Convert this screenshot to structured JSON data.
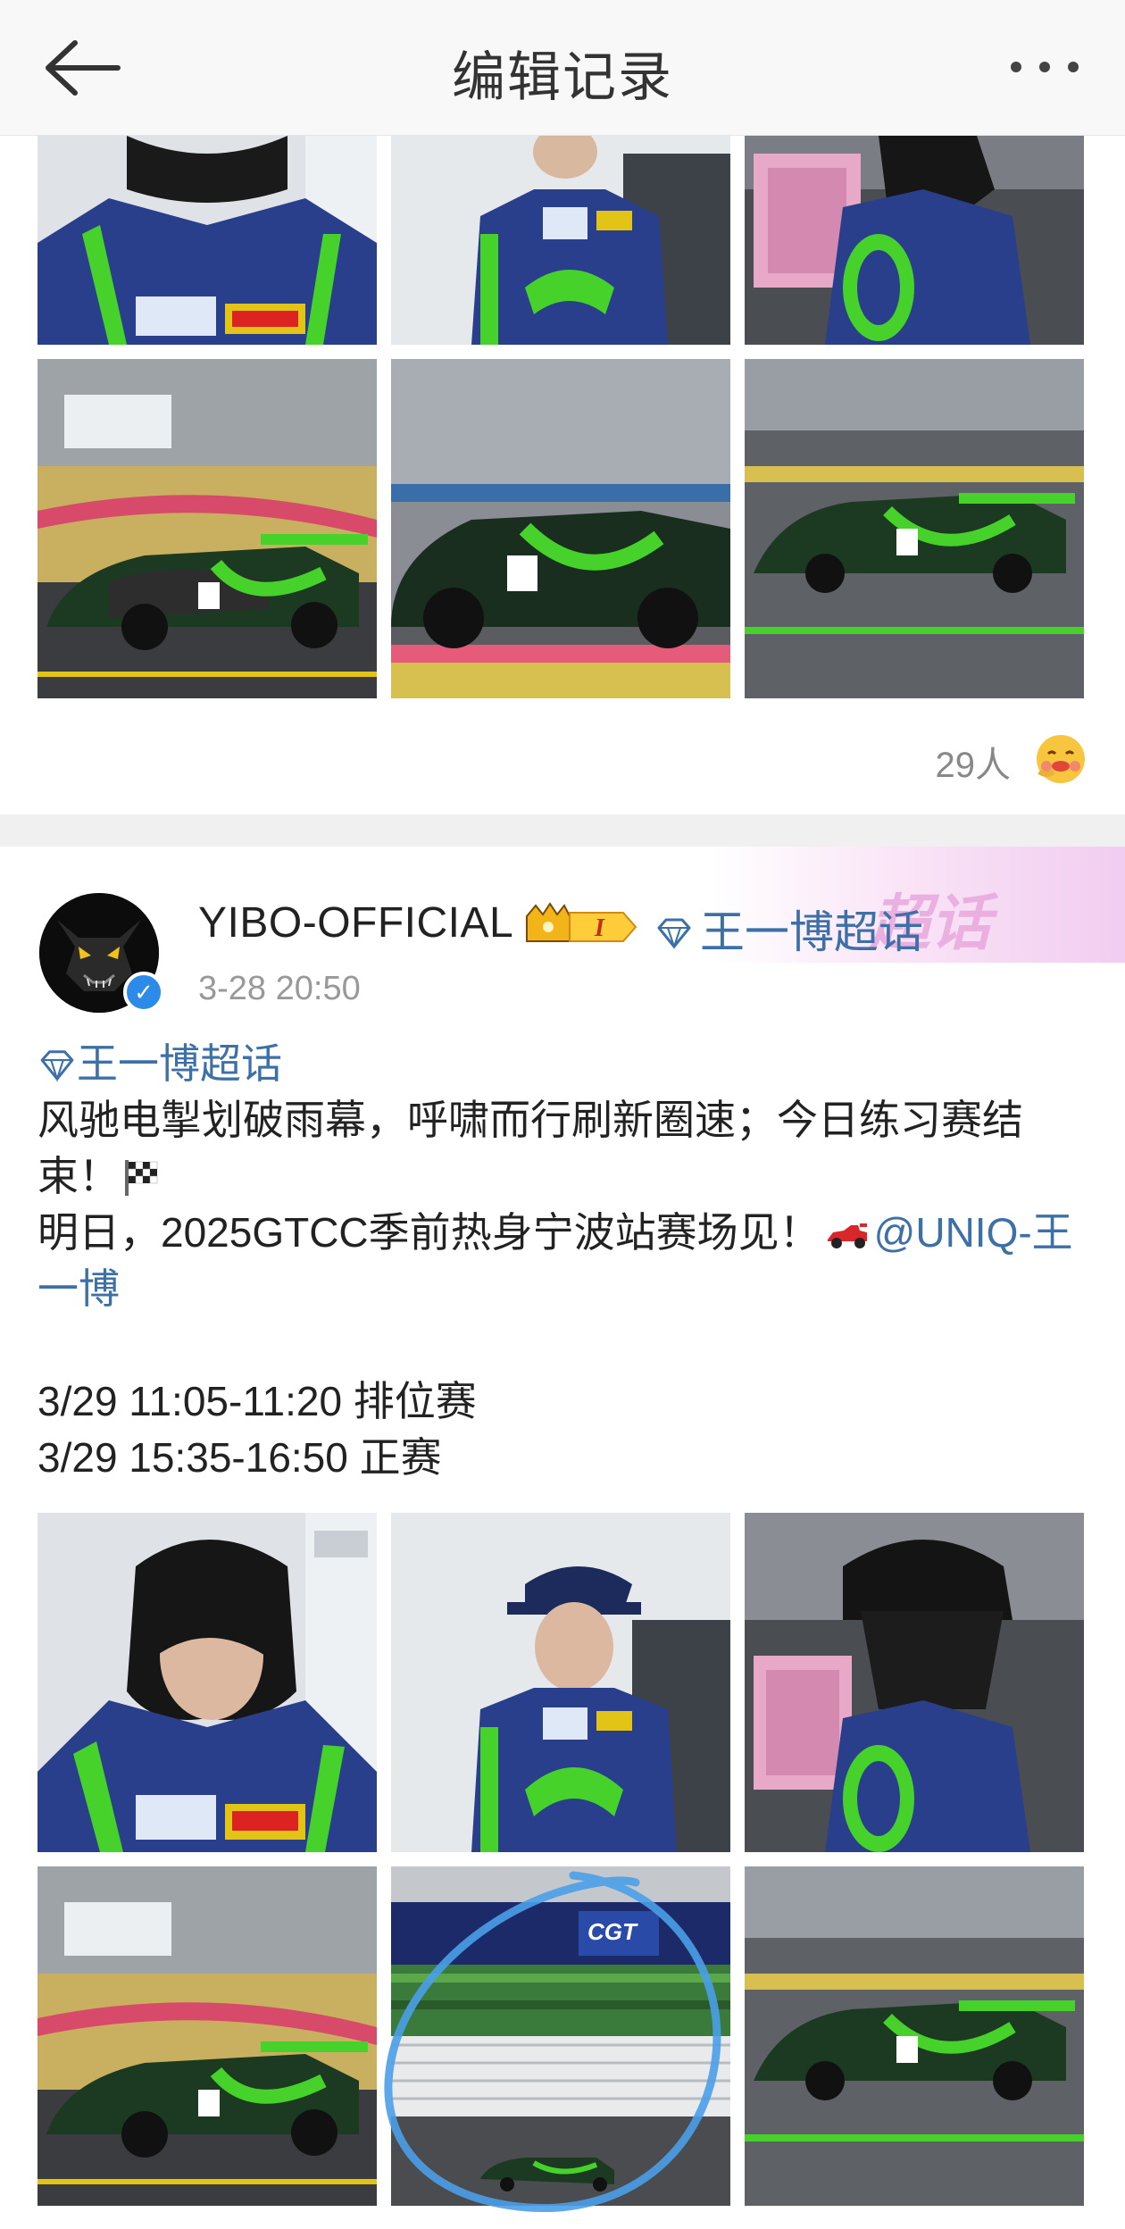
{
  "navbar": {
    "title": "编辑记录",
    "back_icon": "arrow-left-icon",
    "more_icon": "more-horizontal-icon"
  },
  "previous_post": {
    "likes_count": "29人",
    "likes_emoji": "hugging-face-emoji"
  },
  "post": {
    "author": "YIBO-OFFICIAL",
    "badge": "crown-level-badge",
    "header_topic": "王一博超话",
    "timestamp": "3-28 20:50",
    "topic_tag": "王一博超话",
    "text_line1": "风驰电掣划破雨幕，呼啸而行刷新圈速；今日练习赛结束！",
    "text_line2_prefix": "明日，2025GTCC季前热身宁波站赛场见！",
    "mention": "@UNIQ-王一博",
    "schedule_line1": "3/29 11:05-11:20 排位赛",
    "schedule_line2": "3/29 15:35-16:50 正赛",
    "watermark": "超话"
  },
  "colors": {
    "link": "#3e70a8",
    "verified": "#2c8ae8",
    "race_green": "#46d22a",
    "suit_blue": "#2a3f8c"
  }
}
